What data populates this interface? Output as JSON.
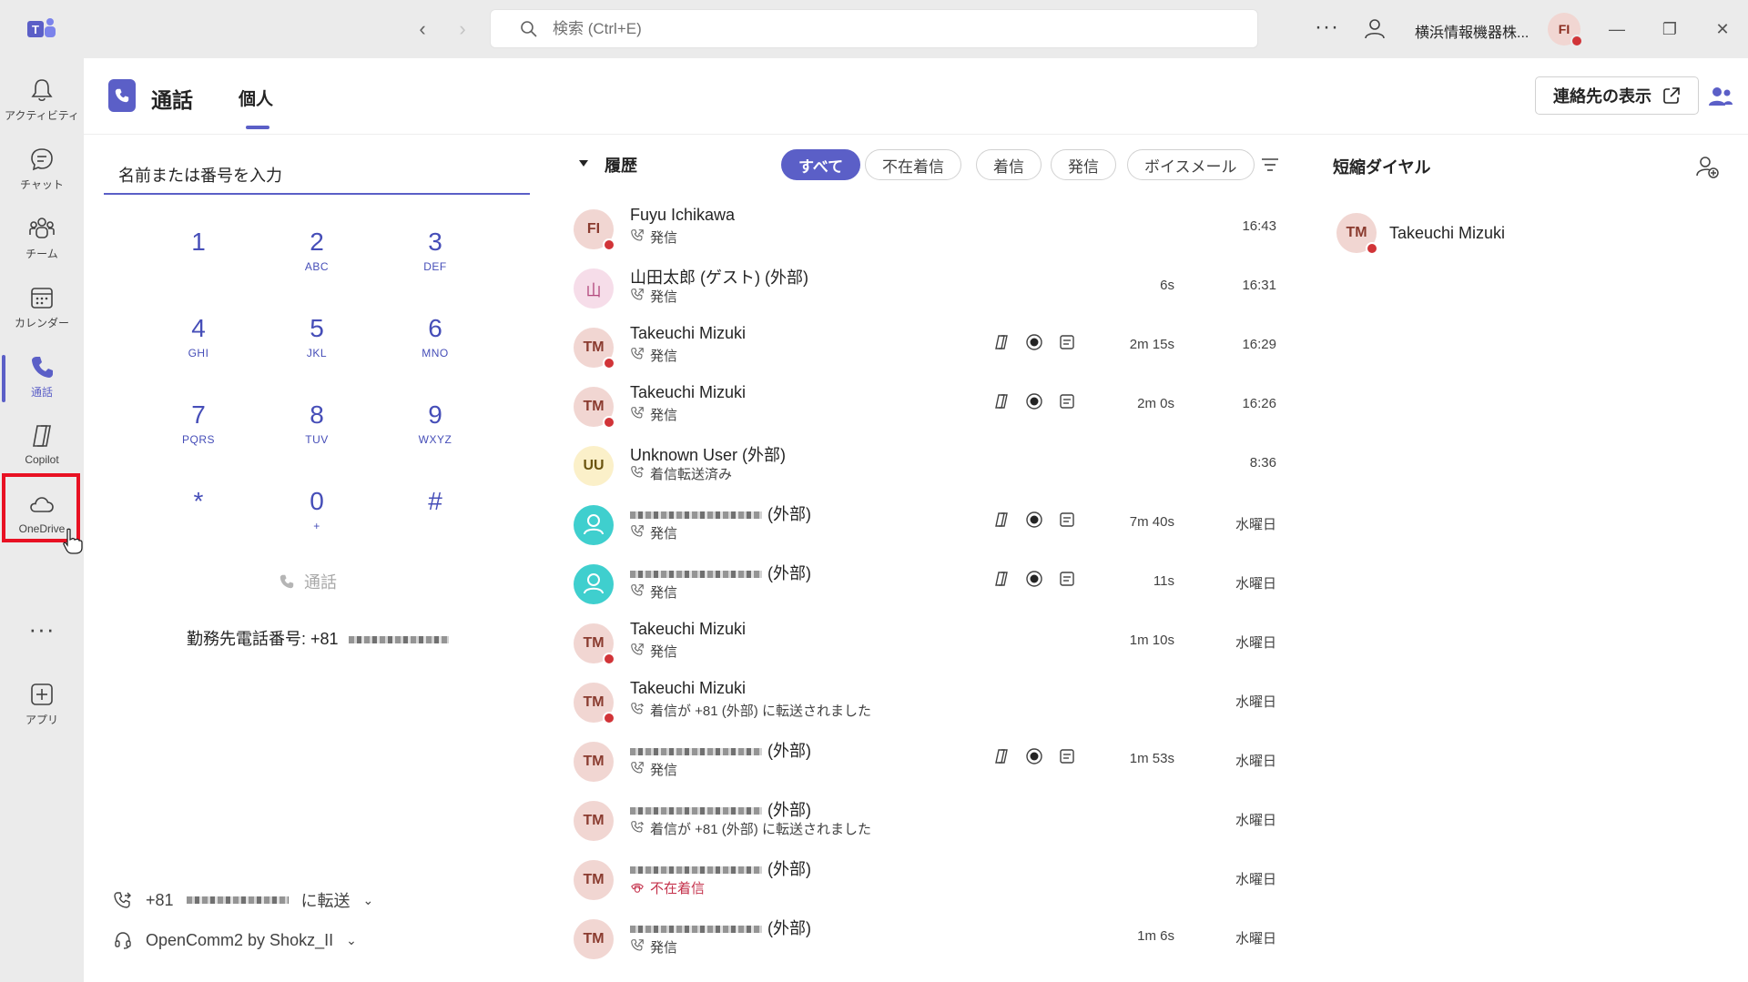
{
  "titlebar": {
    "search_placeholder": "検索 (Ctrl+E)",
    "more": "···",
    "org_name": "横浜情報機器株...",
    "avatar_initials": "FI"
  },
  "rail": {
    "items": [
      {
        "label": "アクティビティ",
        "icon": "bell-icon"
      },
      {
        "label": "チャット",
        "icon": "chat-icon"
      },
      {
        "label": "チーム",
        "icon": "teams-icon"
      },
      {
        "label": "カレンダー",
        "icon": "calendar-icon"
      },
      {
        "label": "通話",
        "icon": "phone-icon"
      },
      {
        "label": "Copilot",
        "icon": "copilot-icon"
      },
      {
        "label": "OneDrive",
        "icon": "cloud-icon"
      },
      {
        "label": "アプリ",
        "icon": "add-app-icon"
      }
    ],
    "more": "···"
  },
  "header": {
    "title": "通話",
    "tab": "個人",
    "contacts_button": "連絡先の表示"
  },
  "dialpad": {
    "input_placeholder": "名前または番号を入力",
    "keys": [
      {
        "num": "1",
        "sub": ""
      },
      {
        "num": "2",
        "sub": "ABC"
      },
      {
        "num": "3",
        "sub": "DEF"
      },
      {
        "num": "4",
        "sub": "GHI"
      },
      {
        "num": "5",
        "sub": "JKL"
      },
      {
        "num": "6",
        "sub": "MNO"
      },
      {
        "num": "7",
        "sub": "PQRS"
      },
      {
        "num": "8",
        "sub": "TUV"
      },
      {
        "num": "9",
        "sub": "WXYZ"
      },
      {
        "num": "*",
        "sub": ""
      },
      {
        "num": "0",
        "sub": "+"
      },
      {
        "num": "#",
        "sub": ""
      }
    ],
    "call_label": "通話",
    "work_phone_label": "勤務先電話番号: +81",
    "forward_prefix": "+81",
    "forward_suffix": "に転送",
    "device": "OpenComm2 by Shokz_II"
  },
  "history": {
    "title": "履歴",
    "filters": [
      "すべて",
      "不在着信",
      "着信",
      "発信",
      "ボイスメール"
    ],
    "rows": [
      {
        "initials": "FI",
        "avatar": "default",
        "presence": true,
        "name": "Fuyu Ichikawa",
        "sub": "発信",
        "sub_type": "outgoing",
        "icons": false,
        "duration": "",
        "time": "16:43"
      },
      {
        "initials": "山",
        "avatar": "pink",
        "presence": false,
        "name": "山田太郎 (ゲスト) (外部)",
        "sub": "発信",
        "sub_type": "outgoing",
        "icons": false,
        "duration": "6s",
        "time": "16:31"
      },
      {
        "initials": "TM",
        "avatar": "default",
        "presence": true,
        "name": "Takeuchi Mizuki",
        "sub": "発信",
        "sub_type": "outgoing",
        "icons": true,
        "duration": "2m 15s",
        "time": "16:29"
      },
      {
        "initials": "TM",
        "avatar": "default",
        "presence": true,
        "name": "Takeuchi Mizuki",
        "sub": "発信",
        "sub_type": "outgoing",
        "icons": true,
        "duration": "2m 0s",
        "time": "16:26"
      },
      {
        "initials": "UU",
        "avatar": "yellow",
        "presence": false,
        "name": "Unknown User (外部)",
        "sub": "着信転送済み",
        "sub_type": "forwarded",
        "icons": false,
        "duration": "",
        "time": "8:36"
      },
      {
        "initials": "",
        "avatar": "teal",
        "presence": false,
        "name": "(外部)",
        "blurred": true,
        "sub": "発信",
        "sub_type": "outgoing",
        "icons": true,
        "duration": "7m 40s",
        "time": "水曜日"
      },
      {
        "initials": "",
        "avatar": "teal",
        "presence": false,
        "name": "(外部)",
        "blurred": true,
        "sub": "発信",
        "sub_type": "outgoing",
        "icons": true,
        "duration": "11s",
        "time": "水曜日"
      },
      {
        "initials": "TM",
        "avatar": "default",
        "presence": true,
        "name": "Takeuchi Mizuki",
        "sub": "発信",
        "sub_type": "outgoing",
        "icons": false,
        "duration": "1m 10s",
        "time": "水曜日"
      },
      {
        "initials": "TM",
        "avatar": "default",
        "presence": true,
        "name": "Takeuchi Mizuki",
        "sub": "着信が +81 (外部) に転送されました",
        "sub_type": "forwarded",
        "icons": false,
        "duration": "",
        "time": "水曜日"
      },
      {
        "initials": "TM",
        "avatar": "default",
        "presence": false,
        "name": "(外部)",
        "blurred": true,
        "sub": "発信",
        "sub_type": "outgoing",
        "icons": true,
        "duration": "1m 53s",
        "time": "水曜日"
      },
      {
        "initials": "TM",
        "avatar": "default",
        "presence": false,
        "name": "(外部)",
        "blurred": true,
        "sub": "着信が +81 (外部) に転送されました",
        "sub_type": "forwarded",
        "icons": false,
        "duration": "",
        "time": "水曜日"
      },
      {
        "initials": "TM",
        "avatar": "default",
        "presence": false,
        "name": "(外部)",
        "blurred": true,
        "sub": "不在着信",
        "sub_type": "missed",
        "icons": false,
        "duration": "",
        "time": "水曜日"
      },
      {
        "initials": "TM",
        "avatar": "default",
        "presence": false,
        "name": "(外部)",
        "blurred": true,
        "sub": "発信",
        "sub_type": "outgoing",
        "icons": false,
        "duration": "1m 6s",
        "time": "水曜日"
      }
    ]
  },
  "speed_dial": {
    "title": "短縮ダイヤル",
    "items": [
      {
        "initials": "TM",
        "name": "Takeuchi Mizuki"
      }
    ]
  },
  "colors": {
    "accent": "#5b5fc7",
    "presence_busy": "#d13438",
    "missed": "#c4314b",
    "highlight": "#e81123"
  }
}
